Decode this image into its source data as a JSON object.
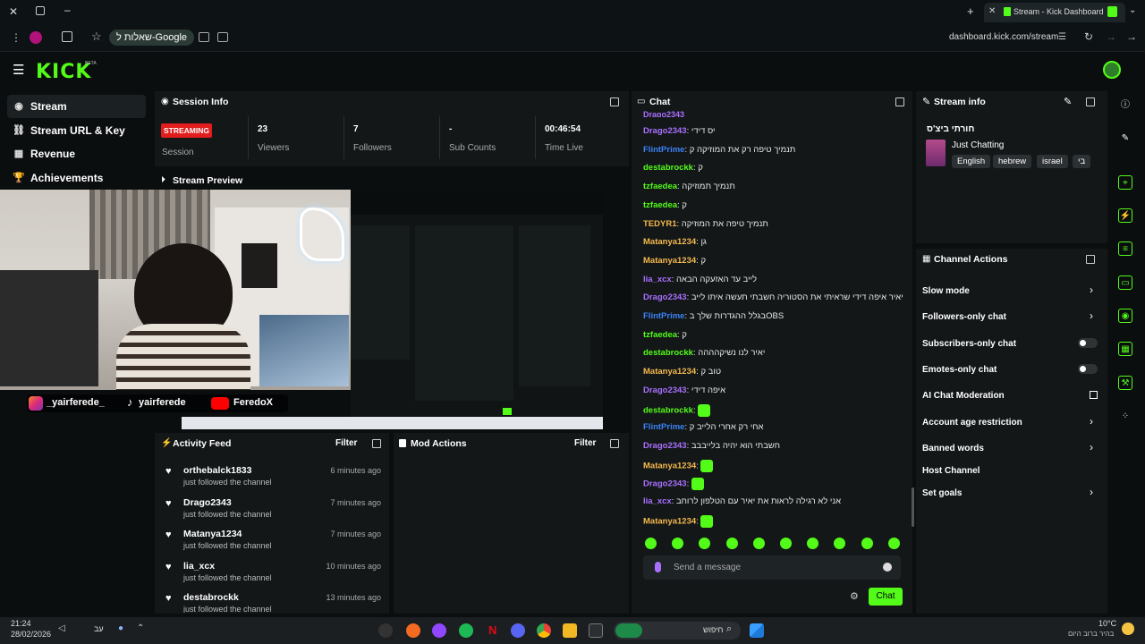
{
  "browser": {
    "tab_title": "Stream - Kick Dashboard",
    "url": "dashboard.kick.com/stream",
    "google_chip": "שאלות ל-Google"
  },
  "app": {
    "logo": "KICK",
    "beta": "BETA"
  },
  "sidebar": {
    "items": [
      {
        "label": "Stream",
        "icon": "stream-icon"
      },
      {
        "label": "Stream URL & Key",
        "icon": "link-icon"
      },
      {
        "label": "Revenue",
        "icon": "revenue-icon"
      },
      {
        "label": "Achievements",
        "icon": "trophy-icon"
      }
    ]
  },
  "session_info": {
    "title": "Session Info",
    "status": "STREAMING",
    "status_label": "Session",
    "viewers_value": "23",
    "viewers_label": "Viewers",
    "followers_value": "7",
    "followers_label": "Followers",
    "subs_value": "-",
    "subs_label": "Sub Counts",
    "time_value": "00:46:54",
    "time_label": "Time Live"
  },
  "stream_preview": {
    "title": "Stream Preview",
    "overlay_handles": [
      "_yairferede_",
      "yairferede",
      "FeredoX"
    ]
  },
  "activity_feed": {
    "title": "Activity Feed",
    "filter": "Filter",
    "items": [
      {
        "name": "orthebalck1833",
        "action": "just followed the channel",
        "time": "6 minutes ago"
      },
      {
        "name": "Drago2343",
        "action": "just followed the channel",
        "time": "7 minutes ago"
      },
      {
        "name": "Matanya1234",
        "action": "just followed the channel",
        "time": "7 minutes ago"
      },
      {
        "name": "lia_xcx",
        "action": "just followed the channel",
        "time": "10 minutes ago"
      },
      {
        "name": "destabrockk",
        "action": "just followed the channel",
        "time": "13 minutes ago"
      }
    ]
  },
  "mod_actions": {
    "title": "Mod Actions",
    "filter": "Filter"
  },
  "chat": {
    "title": "Chat",
    "messages": [
      {
        "user": "Drago2343",
        "text": "יס דידי",
        "color": "#a970ff"
      },
      {
        "user": "FlintPrime",
        "text": "תנמיך טיפה רק את המוזיקה ק",
        "color": "#3b82f6"
      },
      {
        "user": "destabrockk",
        "text": "ק",
        "color": "#53fc18"
      },
      {
        "user": "tzfaedea",
        "text": "תנמיך תמוזיקה",
        "color": "#53fc18"
      },
      {
        "user": "tzfaedea",
        "text": "ק",
        "color": "#53fc18"
      },
      {
        "user": "TEDYR1",
        "text": "תנמיך טיפה את המוזיקה",
        "color": "#f5b94d"
      },
      {
        "user": "Matanya1234",
        "text": "גן",
        "color": "#f5b94d"
      },
      {
        "user": "Matanya1234",
        "text": "ק",
        "color": "#f5b94d"
      },
      {
        "user": "lia_xcx",
        "text": "לייב עד האזעקה הבאה",
        "color": "#a970ff"
      },
      {
        "user": "Drago2343",
        "text": "יאיר איפה דידי שראיתי את הסטוריה חשבתי תעשה איתו לייב",
        "color": "#a970ff"
      },
      {
        "user": "FlintPrime",
        "text": "בגלל ההגדרות שלך בOBS",
        "color": "#3b82f6"
      },
      {
        "user": "tzfaedea",
        "text": "ק",
        "color": "#53fc18"
      },
      {
        "user": "destabrockk",
        "text": "יאיר לנו נשיקהההה",
        "color": "#53fc18"
      },
      {
        "user": "Matanya1234",
        "text": "טוב ק",
        "color": "#f5b94d"
      },
      {
        "user": "Drago2343",
        "text": "איפה דידי",
        "color": "#a970ff"
      },
      {
        "user": "destabrockk",
        "text": "",
        "color": "#53fc18"
      },
      {
        "user": "FlintPrime",
        "text": "אחי רק אחרי הלייב ק",
        "color": "#3b82f6"
      },
      {
        "user": "Drago2343",
        "text": "חשבתי הוא יהיה בלייבבב",
        "color": "#a970ff"
      },
      {
        "user": "Matanya1234",
        "text": "",
        "color": "#f5b94d"
      },
      {
        "user": "Drago2343",
        "text": "",
        "color": "#a970ff"
      },
      {
        "user": "lia_xcx",
        "text": "אני לא רגילה לראות את יאיר עם הטלפון לרוחב",
        "color": "#a970ff"
      },
      {
        "user": "Matanya1234",
        "text": "",
        "color": "#f5b94d"
      }
    ],
    "input_placeholder": "Send a message",
    "send_label": "Chat"
  },
  "stream_info": {
    "title": "Stream info",
    "stream_title": "חורתי ביצ'ס",
    "category": "Just Chatting",
    "tags": [
      "English",
      "hebrew",
      "israel",
      "בי"
    ]
  },
  "channel_actions": {
    "title": "Channel Actions",
    "items": [
      {
        "label": "Slow mode",
        "control": "chevron"
      },
      {
        "label": "Followers-only chat",
        "control": "chevron"
      },
      {
        "label": "Subscribers-only chat",
        "control": "toggle"
      },
      {
        "label": "Emotes-only chat",
        "control": "toggle"
      },
      {
        "label": "AI Chat Moderation",
        "control": "external"
      },
      {
        "label": "Account age restriction",
        "control": "chevron"
      },
      {
        "label": "Banned words",
        "control": "chevron"
      },
      {
        "label": "Host Channel",
        "control": "none"
      },
      {
        "label": "Set goals",
        "control": "chevron"
      }
    ]
  },
  "taskbar": {
    "time": "21:24",
    "date": "28/02/2026",
    "lang": "עב",
    "search": "חיפוש",
    "weather_temp": "10°C",
    "weather_desc": "בהיר ברוב היום"
  },
  "colors": {
    "accent": "#53fc18",
    "live": "#e11d1d"
  }
}
